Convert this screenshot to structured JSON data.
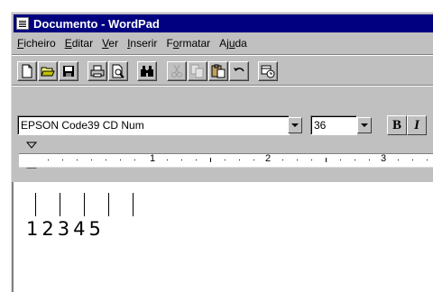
{
  "window": {
    "title": "Documento - WordPad",
    "title_icon": "wordpad-document-icon"
  },
  "menubar": {
    "items": [
      {
        "underline": "F",
        "rest": "icheiro"
      },
      {
        "underline": "E",
        "rest": "ditar"
      },
      {
        "underline": "V",
        "rest": "er"
      },
      {
        "underline": "I",
        "rest": "nserir"
      },
      {
        "prefix": "F",
        "underline": "o",
        "rest": "rmatar"
      },
      {
        "prefix": "Aj",
        "underline": "u",
        "rest": "da"
      }
    ]
  },
  "toolbar": {
    "buttons": [
      "new-document-icon",
      "open-folder-icon",
      "save-disk-icon",
      "print-icon",
      "print-preview-icon",
      "find-binoculars-icon",
      "cut-scissors-icon",
      "copy-icon",
      "paste-icon",
      "undo-icon",
      "date-time-icon"
    ]
  },
  "format": {
    "font_name": "EPSON Code39 CD Num",
    "font_size": "36",
    "bold_label": "B",
    "italic_label": "I"
  },
  "ruler": {
    "labels": [
      "1",
      "2",
      "3"
    ]
  },
  "document": {
    "text": "12345"
  }
}
